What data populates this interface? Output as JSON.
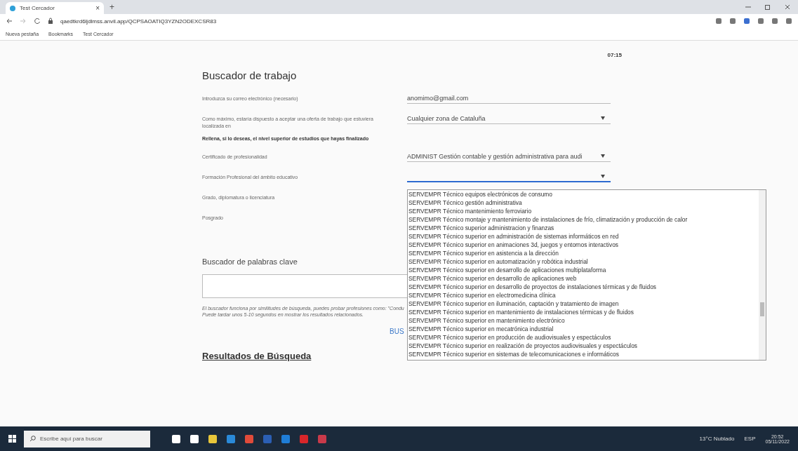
{
  "browser": {
    "tab": {
      "title": "Test Cercador",
      "close": "×"
    },
    "new_tab": "+",
    "address": "qaedtkrd6ljdlmss.anvil.app/QCPSAOATIQ3YZN2ODEXCSR83",
    "bookmarks": [
      "Nueva pestaña",
      "Bookmarks",
      "Test Cercador"
    ]
  },
  "page": {
    "timer": "07:15",
    "title": "Buscador de trabajo",
    "fields": [
      {
        "kind": "input",
        "label": "Introduzca su correo electrónico (necesario)",
        "value": "anomimo@gmail.com"
      },
      {
        "kind": "select",
        "label": "Como máximo, estaría dispuesto a aceptar una oferta de trabajo que estuviera localizada en",
        "value": "Cualquier zona de Cataluña",
        "focused": false
      },
      {
        "kind": "heading",
        "label": "Rellena, si lo deseas, el nivel superior de estudios que hayas finalizado"
      },
      {
        "kind": "select",
        "label": "Certificado de profesionalidad",
        "value": "ADMINIST Gestión contable y gestión administrativa para audi",
        "focused": false
      },
      {
        "kind": "select",
        "label": "Formación Profesional del ámbito educativo",
        "focused": true
      },
      {
        "kind": "label",
        "label": "Grado, diplomatura o licenciatura"
      },
      {
        "kind": "label",
        "label": "Posgrado"
      }
    ],
    "dropdown_options": [
      "SERVEMPR Técnico equipos electrónicos de consumo",
      "SERVEMPR Técnico gestión administrativa",
      "SERVEMPR Técnico mantenimiento ferroviario",
      "SERVEMPR Técnico montaje y mantenimiento de instalaciones de frío, climatización y producción de calor",
      "SERVEMPR Técnico superior administracion y finanzas",
      "SERVEMPR Técnico superior en administración de sistemas informáticos en red",
      "SERVEMPR Técnico superior en animaciones 3d, juegos y entornos interactivos",
      "SERVEMPR Técnico superior en asistencia a la dirección",
      "SERVEMPR Técnico superior en automatización y robótica industrial",
      "SERVEMPR Técnico superior en desarrollo de aplicaciones multiplataforma",
      "SERVEMPR Técnico superior en desarrollo de aplicaciones web",
      "SERVEMPR Técnico superior en desarrollo de proyectos de instalaciones térmicas y de fluidos",
      "SERVEMPR Técnico superior en electromedicina clínica",
      "SERVEMPR Técnico superior en iluminación, captación y tratamiento de imagen",
      "SERVEMPR Técnico superior en mantenimiento de instalaciones térmicas y de fluidos",
      "SERVEMPR Técnico superior en mantenimiento electrónico",
      "SERVEMPR Técnico superior en mecatrónica industrial",
      "SERVEMPR Técnico superior en producción de audiovisuales y espectáculos",
      "SERVEMPR Técnico superior en realización de proyectos audiovisuales y espectáculos",
      "SERVEMPR Técnico superior en sistemas de telecomunicaciones e informáticos"
    ],
    "keyword_title": "Buscador de palabras clave",
    "help_lines": [
      "El buscador funciona por similitudes de búsqueda, puedes probar profesiones como: \"Condu",
      "Puede tardar unos 5-10 segundos en mostrar los resultados relacionados."
    ],
    "search_button": "BUS",
    "results_title": "Resultados de Búsqueda"
  },
  "taskbar": {
    "search_placeholder": "Escribe aquí para buscar",
    "weather": "13°C Nublado",
    "language": "ESP",
    "time": "20:52",
    "date": "05/11/2022"
  }
}
